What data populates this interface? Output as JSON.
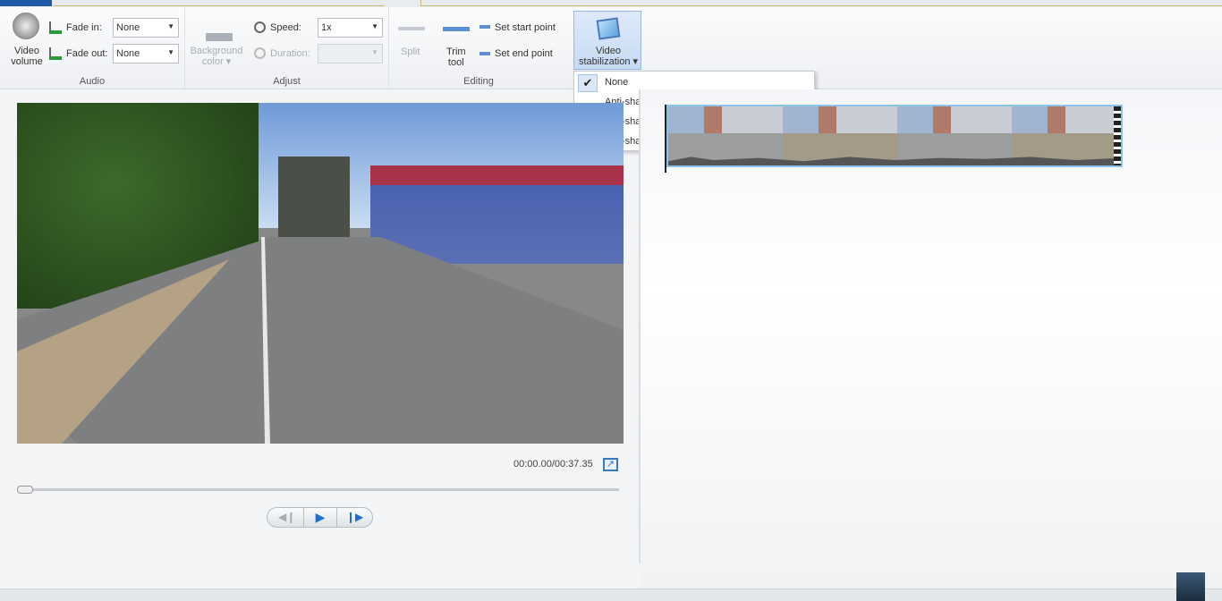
{
  "ribbon": {
    "audio": {
      "group": "Audio",
      "video_volume": "Video\nvolume",
      "fade_in_label": "Fade in:",
      "fade_in_value": "None",
      "fade_out_label": "Fade out:",
      "fade_out_value": "None"
    },
    "adjust": {
      "group": "Adjust",
      "background_color": "Background\ncolor ▾",
      "speed_label": "Speed:",
      "speed_value": "1x",
      "duration_label": "Duration:",
      "duration_value": ""
    },
    "editing": {
      "group": "Editing",
      "split": "Split",
      "trim_tool": "Trim\ntool",
      "set_start": "Set start point",
      "set_end": "Set end point"
    },
    "stabilization": {
      "label": "Video\nstabilization ▾"
    }
  },
  "stabilization_menu": {
    "items": [
      "None",
      "Anti-shake",
      "Anti-shake and wobble correction - low",
      "Anti-shake and wobble correction - high"
    ],
    "selected": "None"
  },
  "player": {
    "time": "00:00.00/00:37.35",
    "progress": 0
  },
  "colors": {
    "accent": "#1e5aa8",
    "selection": "#8cc3e8"
  }
}
